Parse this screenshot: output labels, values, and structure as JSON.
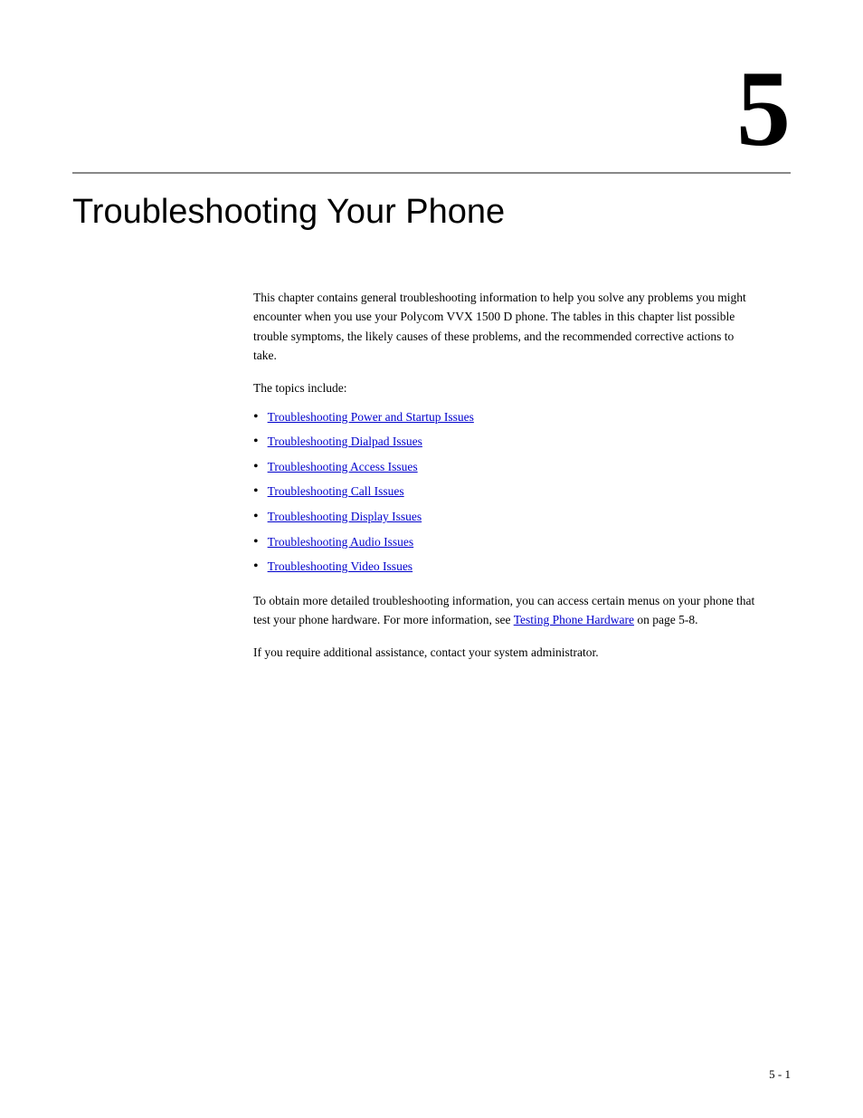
{
  "chapter": {
    "number": "5",
    "title": "Troubleshooting Your Phone",
    "intro": "This chapter contains general troubleshooting information to help you solve any problems you might encounter when you use your Polycom VVX 1500 D phone. The tables in this chapter list possible trouble symptoms, the likely causes of these problems, and the recommended corrective actions to take.",
    "topics_label": "The topics include:",
    "topics": [
      {
        "label": "Troubleshooting Power and Startup Issues",
        "href": "#power"
      },
      {
        "label": "Troubleshooting Dialpad Issues",
        "href": "#dialpad"
      },
      {
        "label": "Troubleshooting Access Issues",
        "href": "#access"
      },
      {
        "label": "Troubleshooting Call Issues",
        "href": "#call"
      },
      {
        "label": "Troubleshooting Display Issues",
        "href": "#display"
      },
      {
        "label": "Troubleshooting Audio Issues",
        "href": "#audio"
      },
      {
        "label": "Troubleshooting Video Issues",
        "href": "#video"
      }
    ],
    "footer1_prefix": "To obtain more detailed troubleshooting information, you can access certain menus on your phone that test your phone hardware. For more information, see ",
    "footer1_link": "Testing Phone Hardware",
    "footer1_suffix": " on page 5-8.",
    "footer2": "If you require additional assistance, contact your system administrator.",
    "page_number": "5 - 1"
  }
}
